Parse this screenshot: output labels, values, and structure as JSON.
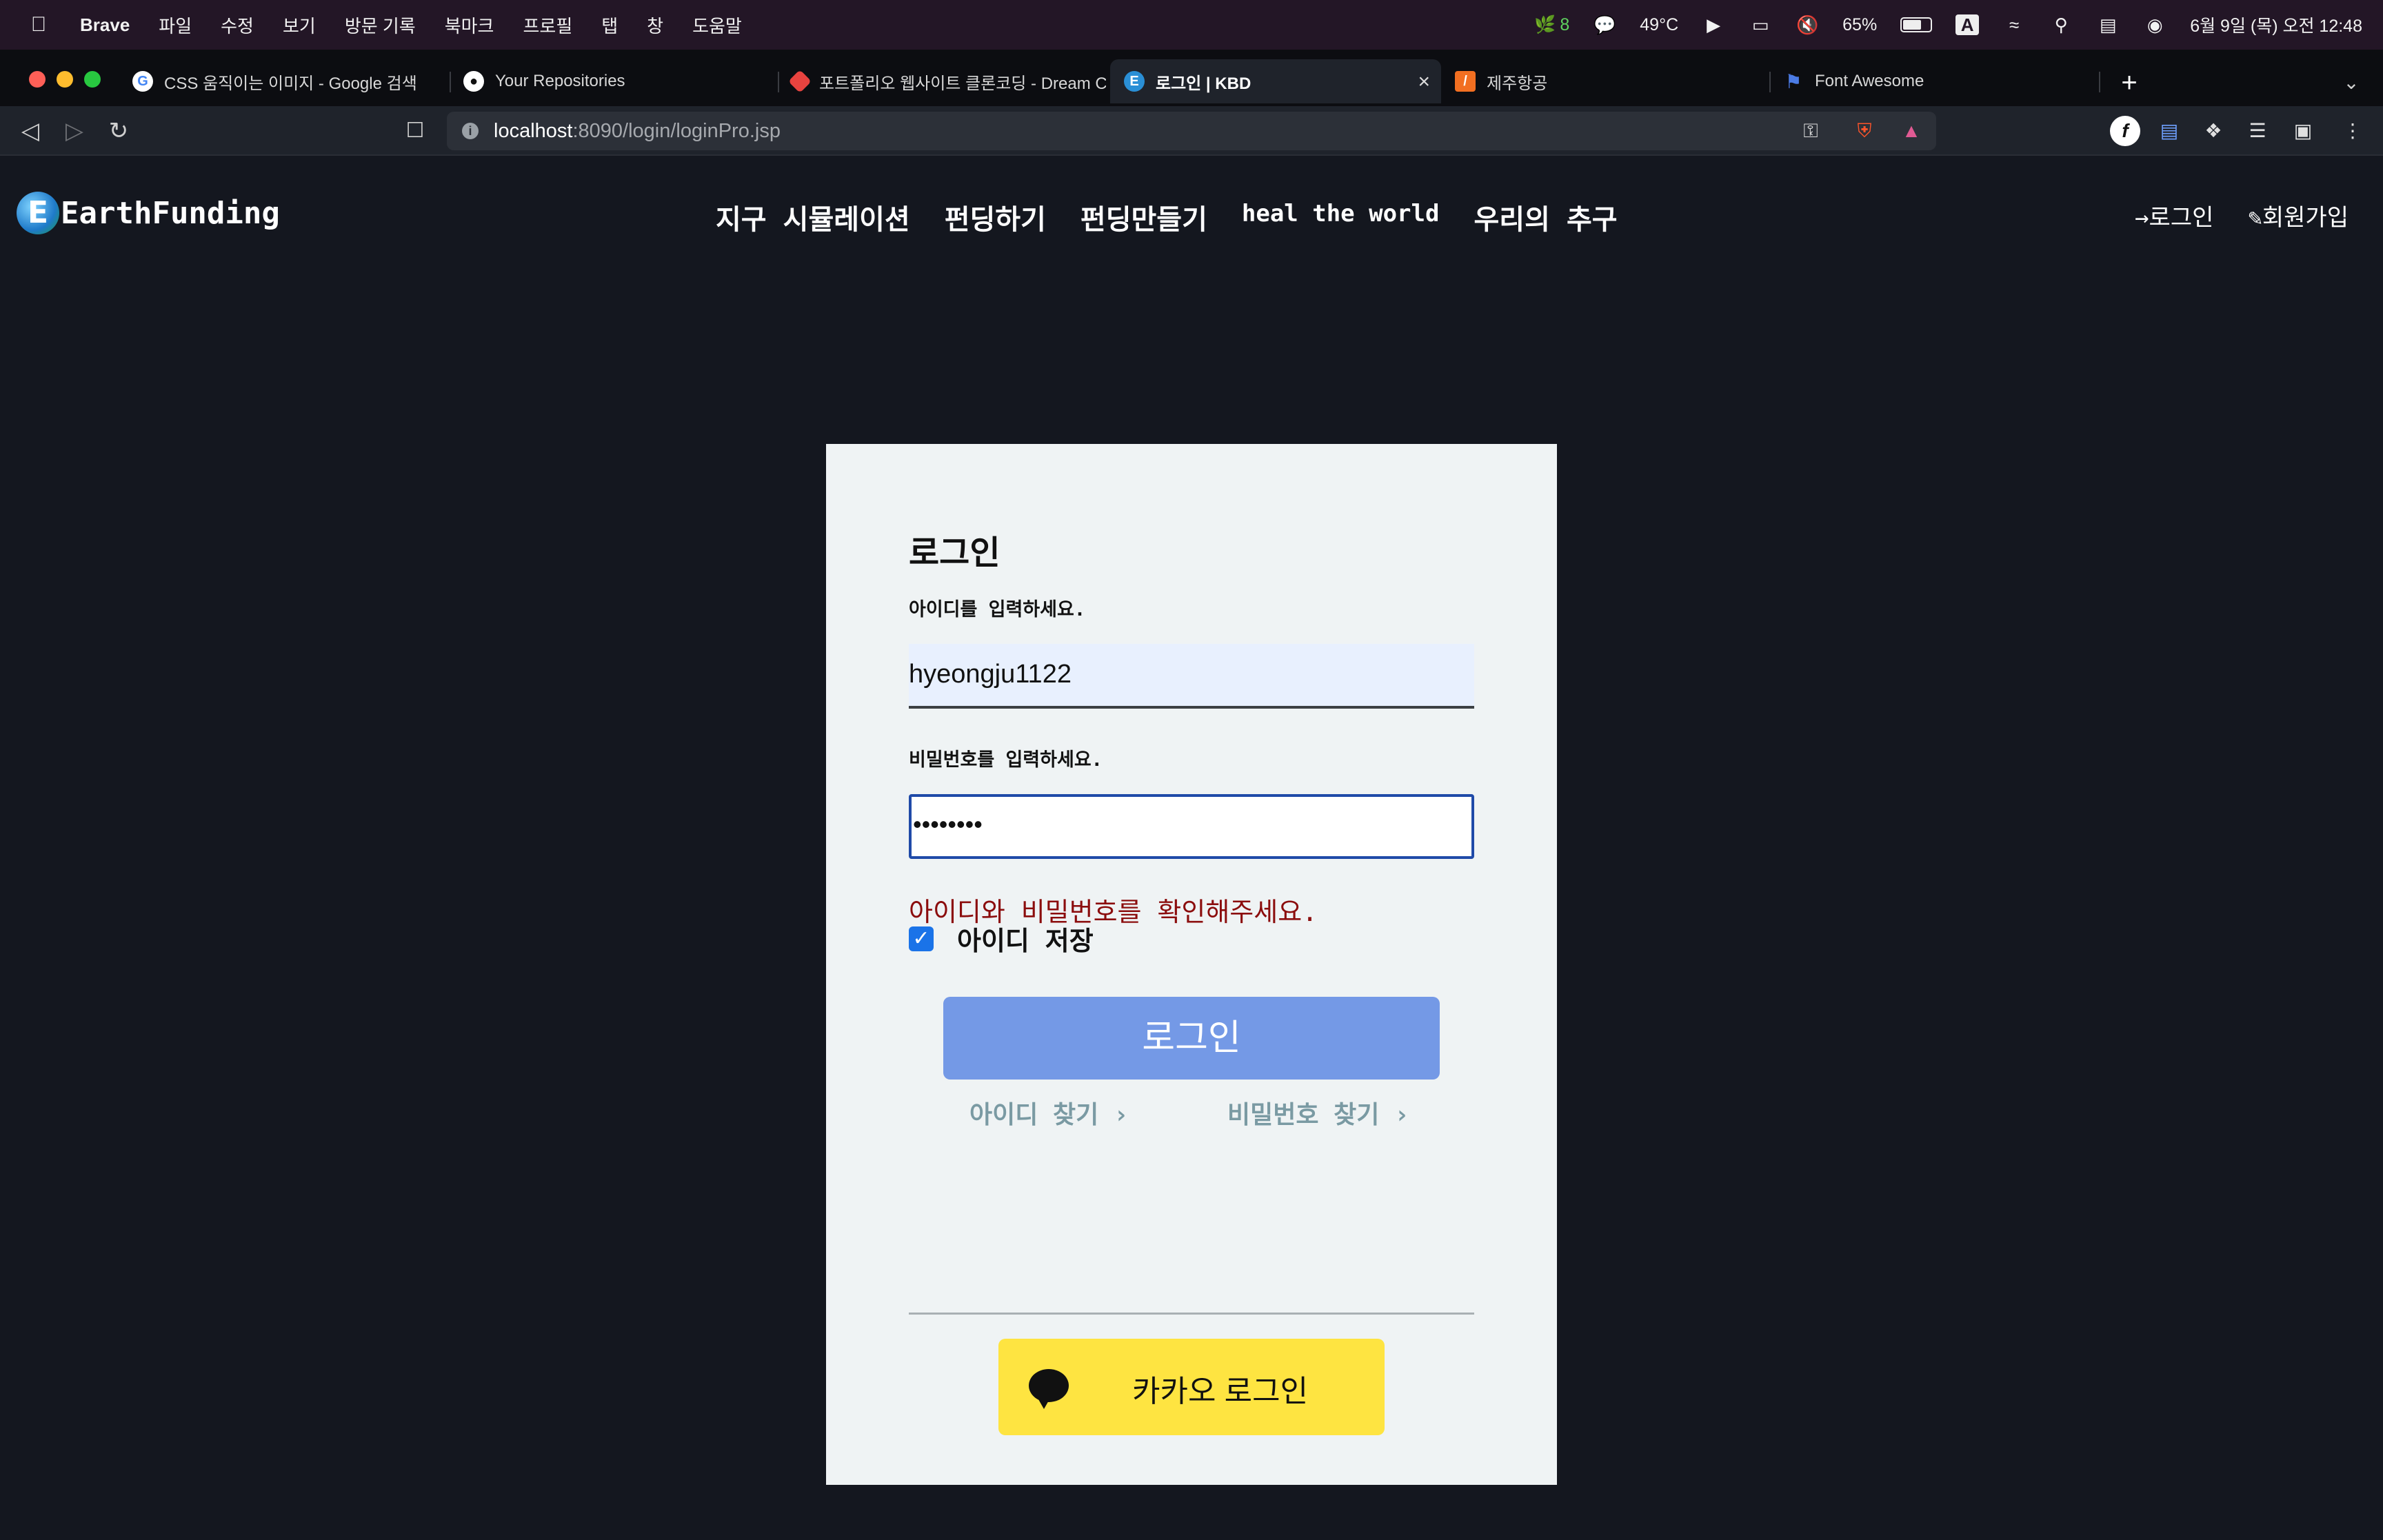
{
  "menubar": {
    "app": "Brave",
    "items": [
      "파일",
      "수정",
      "보기",
      "방문 기록",
      "북마크",
      "프로필",
      "탭",
      "창",
      "도움말"
    ],
    "status": {
      "leaf_count": "8",
      "temperature": "49°C",
      "battery": "65%",
      "input_mode": "A",
      "datetime": "6월 9일 (목) 오전 12:48"
    }
  },
  "tabs": [
    {
      "title": "CSS 움직이는 이미지 - Google 검색",
      "icon": "google-icon"
    },
    {
      "title": "Your Repositories",
      "icon": "github-icon"
    },
    {
      "title": "포트폴리오 웹사이트 클론코딩 - Dream C",
      "icon": "dream-coding-icon"
    },
    {
      "title": "로그인 | KBD",
      "icon": "earth-icon",
      "active": true
    },
    {
      "title": "제주항공",
      "icon": "jeju-air-icon"
    },
    {
      "title": "Font Awesome",
      "icon": "flag-icon"
    }
  ],
  "toolbar": {
    "url_host": "localhost",
    "url_rest": ":8090/login/loginPro.jsp"
  },
  "site": {
    "logo_text": "EarthFunding",
    "logo_letter": "E",
    "nav": [
      "지구 시뮬레이션",
      "펀딩하기",
      "펀딩만들기",
      "heal the world",
      "우리의 추구"
    ],
    "login_link": "로그인",
    "signup_link": "회원가입"
  },
  "login": {
    "title": "로그인",
    "id_label": "아이디를 입력하세요.",
    "id_value": "hyeongju1122",
    "pw_label": "비밀번호를 입력하세요.",
    "pw_value": "••••••••",
    "error": "아이디와 비밀번호를 확인해주세요.",
    "remember_label": "아이디 저장",
    "remember_checked": true,
    "submit": "로그인",
    "find_id": "아이디 찾기 ›",
    "find_pw": "비밀번호 찾기 ›",
    "kakao": "카카오 로그인"
  },
  "colors": {
    "page_bg": "#14171f",
    "card_bg": "#eff3f4",
    "login_button": "#7499e6",
    "error": "#8b0d0d",
    "kakao": "#fee441",
    "link": "#7a9aa3"
  }
}
